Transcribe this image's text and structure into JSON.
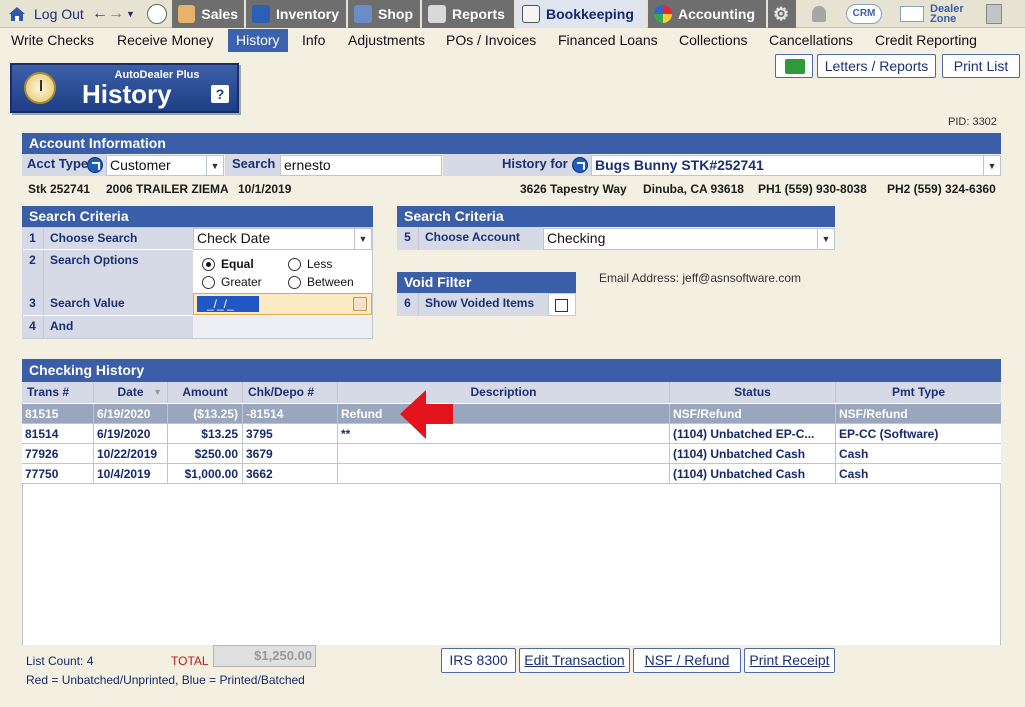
{
  "topnav": {
    "logout": "Log Out",
    "sales": "Sales",
    "inventory": "Inventory",
    "shop": "Shop",
    "reports": "Reports",
    "bookkeeping": "Bookkeeping",
    "accounting": "Accounting",
    "crm": "CRM",
    "dealer_zone_1": "Dealer",
    "dealer_zone_2": "Zone"
  },
  "subnav": [
    "Write Checks",
    "Receive Money",
    "History",
    "Info",
    "Adjustments",
    "POs / Invoices",
    "Financed Loans",
    "Collections",
    "Cancellations",
    "Credit Reporting"
  ],
  "badge": {
    "sub": "AutoDealer Plus",
    "title": "History",
    "help": "?"
  },
  "toolbar": {
    "letters": "Letters / Reports",
    "print_list": "Print List",
    "print_list_underline": "L"
  },
  "pid": "PID: 3302",
  "account": {
    "header": "Account Information",
    "acct_type_label": "Acct Type",
    "acct_type_value": "Customer",
    "search_label": "Search",
    "search_value": "ernesto",
    "history_for_label": "History for",
    "history_for_value": "Bugs Bunny  STK#252741",
    "stk": "Stk 252741",
    "vehicle": "2006 TRAILER ZIEMA",
    "date": "10/1/2019",
    "address": "3626 Tapestry Way",
    "city": "Dinuba, CA 93618",
    "ph1": "PH1 (559) 930-8038",
    "ph2": "PH2 (559) 324-6360"
  },
  "search_criteria": {
    "header": "Search Criteria",
    "rows": [
      {
        "n": "1",
        "label": "Choose Search",
        "value": "Check Date"
      },
      {
        "n": "2",
        "label": "Search Options"
      },
      {
        "n": "3",
        "label": "Search Value",
        "value": "_/_/_"
      },
      {
        "n": "4",
        "label": "And"
      }
    ],
    "options": {
      "equal": "Equal",
      "less": "Less",
      "greater": "Greater",
      "between": "Between"
    }
  },
  "search_criteria2": {
    "header": "Search Criteria",
    "n": "5",
    "label": "Choose Account",
    "value": "Checking"
  },
  "void_filter": {
    "header": "Void Filter",
    "n": "6",
    "label": "Show Voided Items"
  },
  "email": "Email Address: jeff@asnsoftware.com",
  "history": {
    "header": "Checking History",
    "columns": [
      "Trans #",
      "Date",
      "Amount",
      "Chk/Depo #",
      "Description",
      "Status",
      "Pmt Type"
    ],
    "rows": [
      {
        "trans": "81515",
        "date": "6/19/2020",
        "amount": "($13.25)",
        "chk": "-81514",
        "desc": "Refund",
        "status": "NSF/Refund",
        "pmt": "NSF/Refund"
      },
      {
        "trans": "81514",
        "date": "6/19/2020",
        "amount": "$13.25",
        "chk": "3795",
        "desc": "**",
        "status": "(1104) Unbatched EP-C...",
        "pmt": "EP-CC (Software)"
      },
      {
        "trans": "77926",
        "date": "10/22/2019",
        "amount": "$250.00",
        "chk": "3679",
        "desc": "",
        "status": "(1104) Unbatched Cash",
        "pmt": "Cash"
      },
      {
        "trans": "77750",
        "date": "10/4/2019",
        "amount": "$1,000.00",
        "chk": "3662",
        "desc": "",
        "status": "(1104) Unbatched Cash",
        "pmt": "Cash"
      }
    ]
  },
  "footer": {
    "list_count": "List Count: 4",
    "total_label": "TOTAL",
    "total_value": "$1,250.00",
    "legend": "Red = Unbatched/Unprinted, Blue = Printed/Batched",
    "irs": "IRS 8300",
    "edit": "Edit Transaction",
    "nsf": "NSF / Refund",
    "receipt": "Print Receipt"
  },
  "colors": {
    "accent": "#3b5ea8",
    "arrow": "#e3131b",
    "selected_row": "#9aa6bd"
  }
}
